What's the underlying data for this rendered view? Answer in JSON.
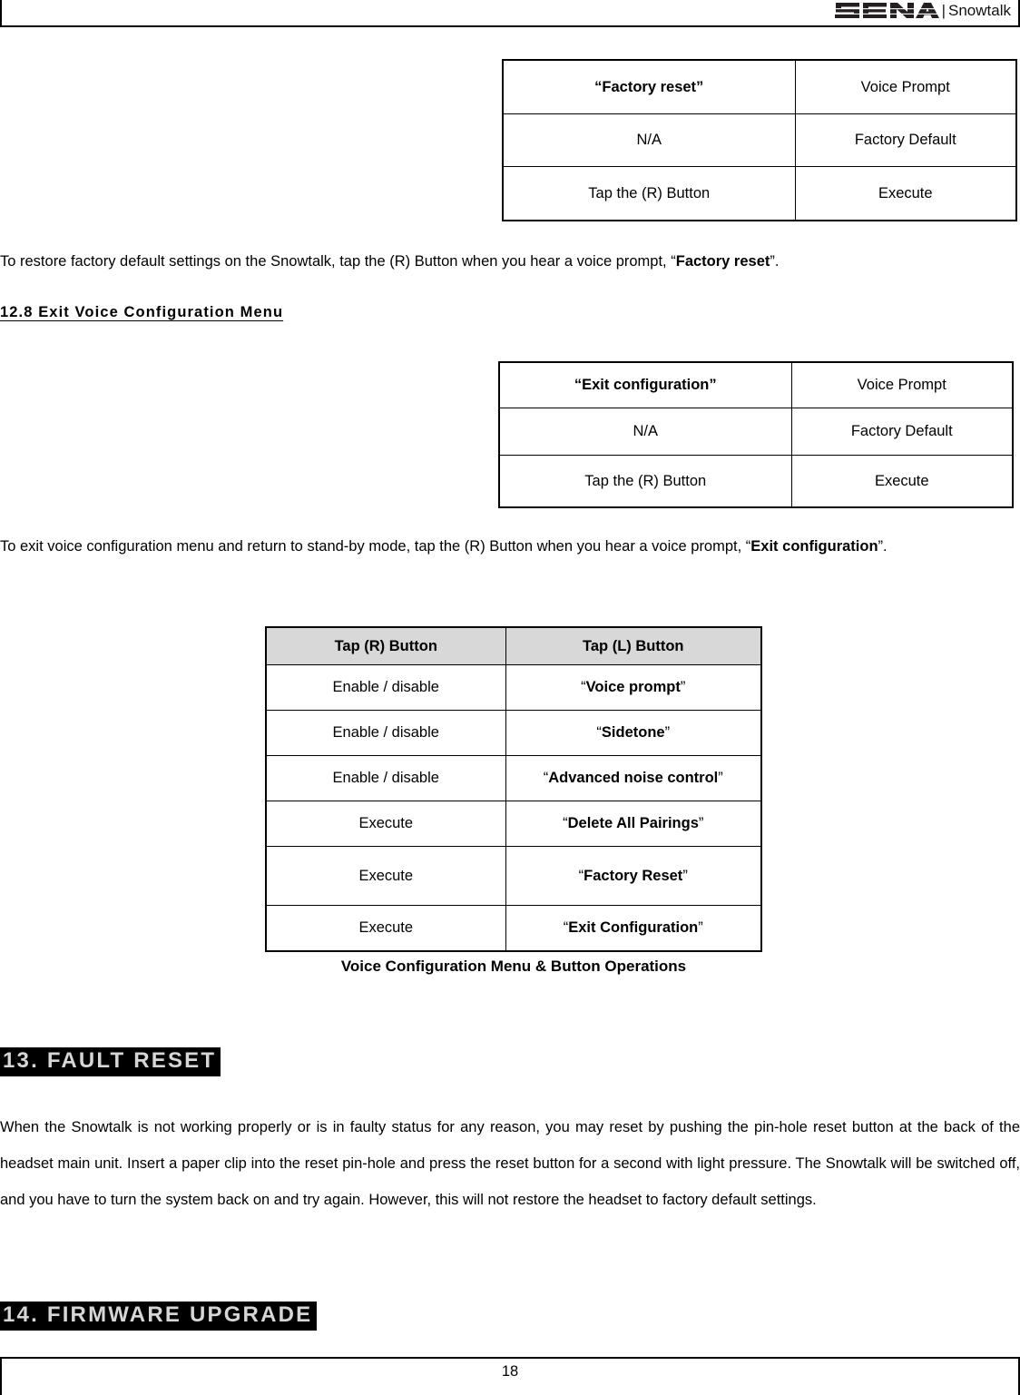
{
  "header": {
    "logo_text": "SENA",
    "separator": "|",
    "product": "Snowtalk",
    "logo_icon": "sena-logo-icon"
  },
  "factory_reset_table": {
    "rows": [
      {
        "left": "“Factory reset”",
        "right": "Voice Prompt",
        "left_bold": true
      },
      {
        "left": "N/A",
        "right": "Factory Default",
        "left_bold": false
      },
      {
        "left": "Tap the (R) Button",
        "right": "Execute",
        "left_bold": false
      }
    ]
  },
  "factory_reset_paragraph": {
    "part1": "To restore factory default settings on the Snowtalk, tap the (R) Button when you hear a voice prompt, “",
    "bold": "Factory reset",
    "part2": "”."
  },
  "section_12_8": {
    "heading": "12.8 Exit Voice Configuration Menu"
  },
  "exit_config_table": {
    "rows": [
      {
        "left": "“Exit configuration”",
        "right": "Voice Prompt",
        "left_bold": true
      },
      {
        "left": "N/A",
        "right": "Factory Default",
        "left_bold": false
      },
      {
        "left": "Tap the (R) Button",
        "right": "Execute",
        "left_bold": false
      }
    ]
  },
  "exit_config_paragraph": {
    "part1": "To exit voice configuration menu and return to stand-by mode, tap the (R) Button when you hear a voice prompt, “",
    "bold1": "Exit",
    "bold2": "configuration",
    "part2": "”."
  },
  "menu_table": {
    "headers": [
      "Tap (R) Button",
      "Tap (L) Button"
    ],
    "rows": [
      {
        "action": "Enable / disable",
        "prompt_open": "“",
        "prompt": "Voice prompt",
        "prompt_close": "”"
      },
      {
        "action": "Enable / disable",
        "prompt_open": "“",
        "prompt": "Sidetone",
        "prompt_close": "”"
      },
      {
        "action": "Enable / disable",
        "prompt_open": "“",
        "prompt": "Advanced noise control",
        "prompt_close": "”"
      },
      {
        "action": "Execute",
        "prompt_open": "“",
        "prompt": "Delete All Pairings",
        "prompt_close": "”"
      },
      {
        "action": "Execute",
        "prompt_open": "“",
        "prompt": "Factory Reset",
        "prompt_close": "”"
      },
      {
        "action": "Execute",
        "prompt_open": "“",
        "prompt": "Exit Configuration",
        "prompt_close": "”"
      }
    ],
    "caption": "Voice Configuration Menu & Button Operations"
  },
  "section_13": {
    "heading": "13. FAULT RESET",
    "paragraph": "When the Snowtalk is not working properly or is in faulty status for any reason, you may reset by pushing the pin-hole reset button at the back of the headset main unit. Insert a paper clip into the reset pin-hole and press the reset button for a second with light pressure. The Snowtalk will be switched off, and you have to turn the system back on and try again. However, this will not restore the headset to factory default settings."
  },
  "section_14": {
    "heading": "14. FIRMWARE UPGRADE"
  },
  "footer": {
    "page_number": "18"
  },
  "colors": {
    "heading_background": "#000000",
    "heading_text": "#d6d6d6",
    "table_header_background": "#d8d8d8",
    "border": "#000000"
  }
}
